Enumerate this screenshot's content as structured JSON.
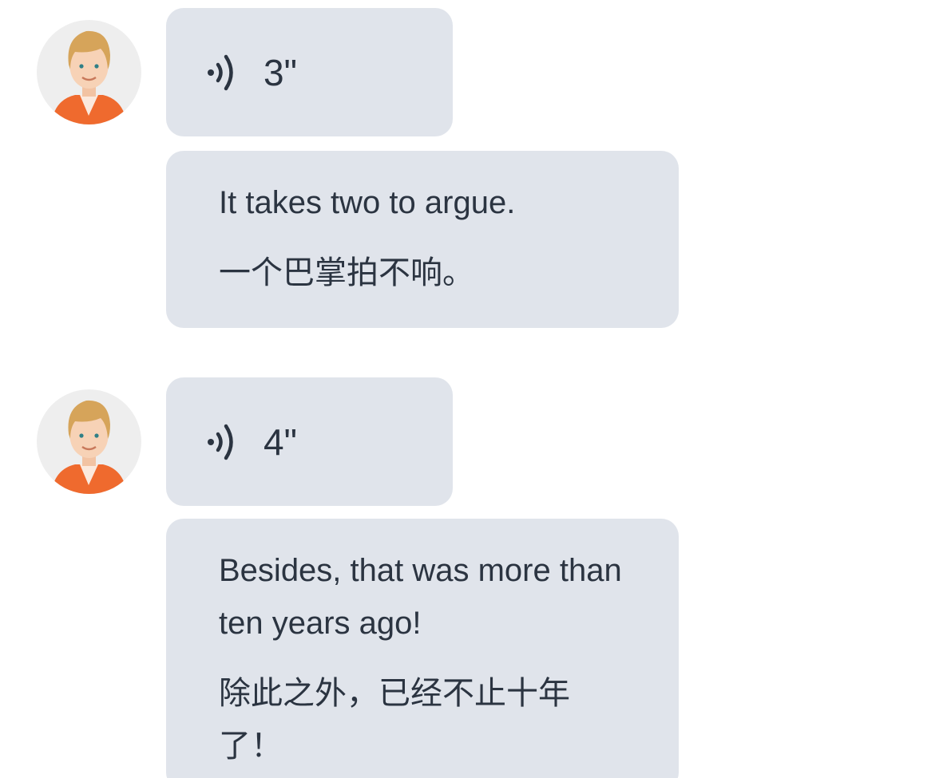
{
  "messages": [
    {
      "voice": {
        "icon": "voice-wave-icon",
        "duration": "3\""
      },
      "text": {
        "english": "It takes two to argue.",
        "chinese": "一个巴掌拍不响。"
      }
    },
    {
      "voice": {
        "icon": "voice-wave-icon",
        "duration": "4\""
      },
      "text": {
        "english": "Besides, that was more than ten years ago!",
        "chinese": "除此之外，已经不止十年了！"
      }
    }
  ],
  "colors": {
    "bubble": "#e0e4eb",
    "text": "#2b3441",
    "avatar_bg": "#eeeeee",
    "shirt": "#ef6a2e"
  }
}
